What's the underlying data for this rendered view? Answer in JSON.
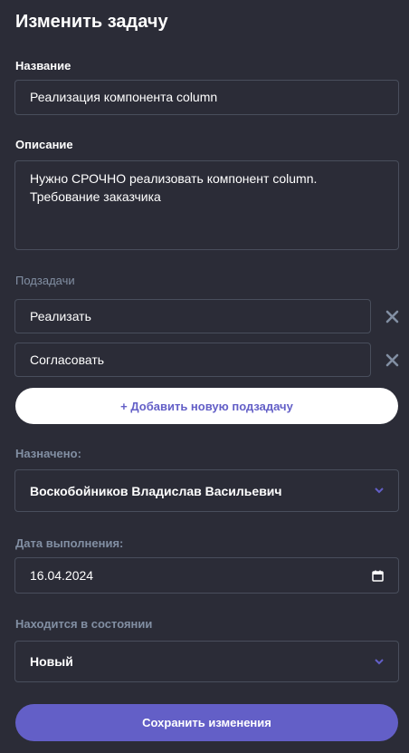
{
  "header": {
    "title": "Изменить задачу"
  },
  "name_field": {
    "label": "Название",
    "value": "Реализация компонента column"
  },
  "description_field": {
    "label": "Описание",
    "value": "Нужно СРОЧНО реализовать компонент column. Требование заказчика"
  },
  "subtasks": {
    "label": "Подзадачи",
    "items": [
      {
        "value": "Реализать"
      },
      {
        "value": "Согласовать"
      }
    ],
    "add_label": "+ Добавить новую подзадачу"
  },
  "assignee": {
    "label": "Назначено:",
    "value": "Воскобойников Владислав Васильевич"
  },
  "due_date": {
    "label": "Дата выполнения:",
    "value": "16.04.2024"
  },
  "status": {
    "label": "Находится в состоянии",
    "value": "Новый"
  },
  "actions": {
    "save_label": "Сохранить изменения"
  },
  "colors": {
    "background": "#2b2c37",
    "accent": "#635fc7",
    "muted": "#828fa3"
  }
}
